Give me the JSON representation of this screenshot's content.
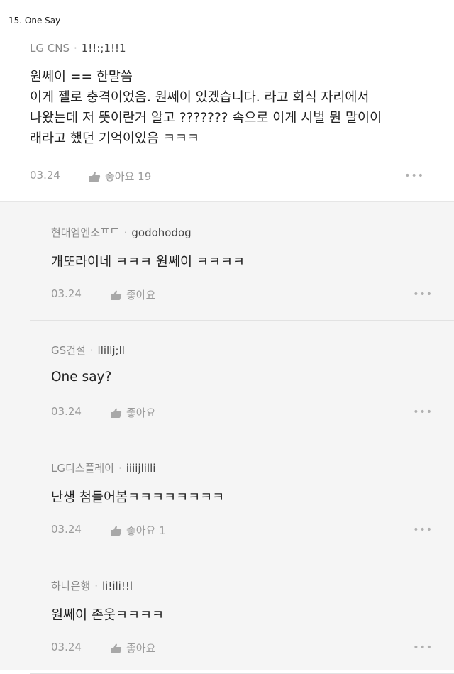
{
  "heading": "15. One Say",
  "main_comment": {
    "company": "LG CNS",
    "user": "1!!:;1!!1",
    "lines": [
      "원쎄이 == 한말씀",
      "이게 젤로 충격이었음. 원쎄이 있겠습니다. 라고 회식 자리에서",
      "나왔는데 저 뜻이란거 알고 ??????? 속으로 이게 시벌 뭔 말이이",
      "래라고 했던 기억이있음 ㅋㅋㅋ"
    ],
    "date": "03.24",
    "like_label": "좋아요 19",
    "more": "•••"
  },
  "replies": [
    {
      "company": "현대엠엔소프트",
      "user": "godohodog",
      "text": "개또라이네 ㅋㅋㅋ 원쎄이 ㅋㅋㅋㅋ",
      "date": "03.24",
      "like_label": "좋아요",
      "more": "•••"
    },
    {
      "company": "GS건설",
      "user": "llillj;ll",
      "text": "One say?",
      "date": "03.24",
      "like_label": "좋아요",
      "more": "•••"
    },
    {
      "company": "LG디스플레이",
      "user": "iiiijlilli",
      "text": "난생 첨들어봄ㅋㅋㅋㅋㅋㅋㅋㅋ",
      "date": "03.24",
      "like_label": "좋아요 1",
      "more": "•••"
    },
    {
      "company": "하나은행",
      "user": "li!ili!!l",
      "text": "원쎄이 존웃ㅋㅋㅋㅋ",
      "date": "03.24",
      "like_label": "좋아요",
      "more": "•••"
    }
  ]
}
